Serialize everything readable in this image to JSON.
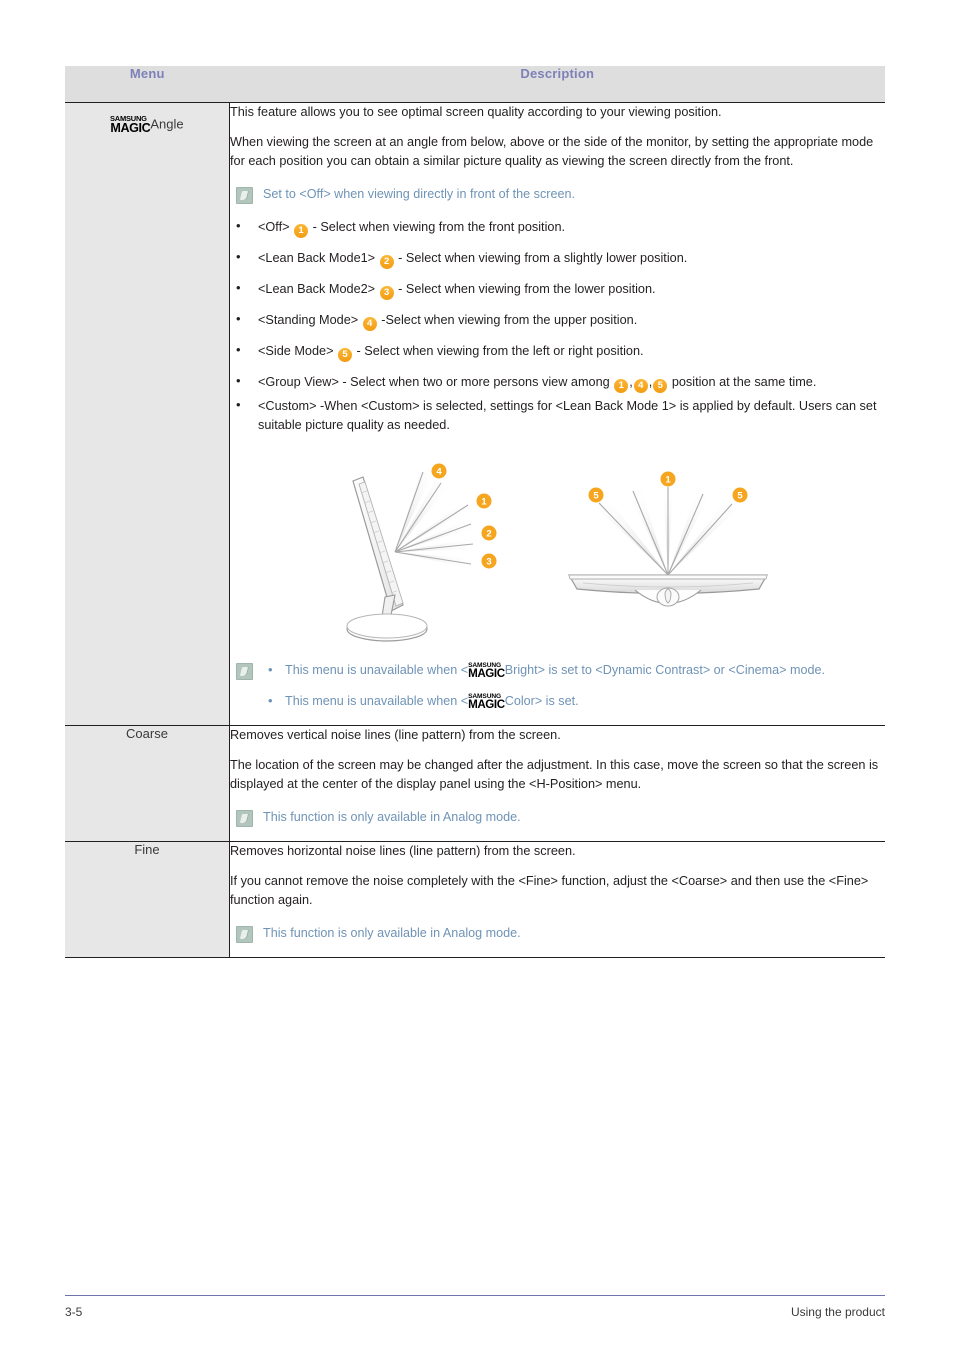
{
  "table": {
    "headers": {
      "menu": "Menu",
      "description": "Description"
    },
    "rows": [
      {
        "menu_logo": {
          "samsung": "SAMSUNG",
          "magic": "MAGIC"
        },
        "menu_label": "Angle",
        "paragraphs": [
          "This feature allows you to see optimal screen quality according to your viewing position.",
          "When viewing the screen at an angle from below, above or the side of the monitor, by setting the appropriate mode for each position you can obtain a similar picture quality as viewing the screen directly from the front."
        ],
        "note_top": "Set to <Off> when viewing directly in front of the screen.",
        "modes": [
          {
            "label": "<Off>",
            "badge": "1",
            "text": "- Select when viewing from the front position."
          },
          {
            "label": "<Lean Back Mode1>",
            "badge": "2",
            "text": "- Select when viewing from a slightly lower position."
          },
          {
            "label": "<Lean Back Mode2>",
            "badge": "3",
            "text": "- Select when viewing from the lower position."
          },
          {
            "label": "<Standing Mode>",
            "badge": "4",
            "text": "-Select when viewing from the upper position."
          },
          {
            "label": "<Side Mode>",
            "badge": "5",
            "text": "- Select when viewing from the left or right position."
          }
        ],
        "group_view": {
          "label": "<Group View>",
          "text_before": "- Select when two or more persons view among",
          "badges": [
            "1",
            "4",
            "5"
          ],
          "text_after": "position at the same time."
        },
        "custom": "<Custom> -When <Custom> is selected, settings for <Lean Back Mode 1> is applied by default. Users can set suitable picture quality as needed.",
        "diagram": {
          "side_view_badges": [
            "4",
            "1",
            "2",
            "3"
          ],
          "top_view_badges": [
            "5",
            "1",
            "5"
          ]
        },
        "note_bottom": [
          {
            "before": "This menu is unavailable when <",
            "logo": {
              "samsung": "SAMSUNG",
              "magic": "MAGIC"
            },
            "after": "Bright> is set to <Dynamic Contrast> or <Cinema> mode."
          },
          {
            "before": "This menu is unavailable when <",
            "logo": {
              "samsung": "SAMSUNG",
              "magic": "MAGIC"
            },
            "after": "Color> is set."
          }
        ]
      },
      {
        "menu_label": "Coarse",
        "paragraphs": [
          "Removes vertical noise lines (line pattern) from the screen.",
          "The location of the screen may be changed after the adjustment. In this case, move the screen so that the screen is displayed at the center of the display panel using the <H-Position> menu."
        ],
        "note": "This function is only available in Analog mode."
      },
      {
        "menu_label": "Fine",
        "paragraphs": [
          "Removes horizontal noise lines (line pattern) from the screen.",
          "If you cannot remove the noise completely with the <Fine> function, adjust the <Coarse> and then use the <Fine> function again."
        ],
        "note": "This function is only available in Analog mode."
      }
    ]
  },
  "footer": {
    "page_number": "3-5",
    "section": "Using the product"
  },
  "colors": {
    "header_text": "#7e81b8",
    "header_bg": "#dedede",
    "menu_bg": "#e7e7e7",
    "note_text": "#6f93b6",
    "badge": "#f5a51e",
    "footer_rule": "#6f74ac"
  }
}
